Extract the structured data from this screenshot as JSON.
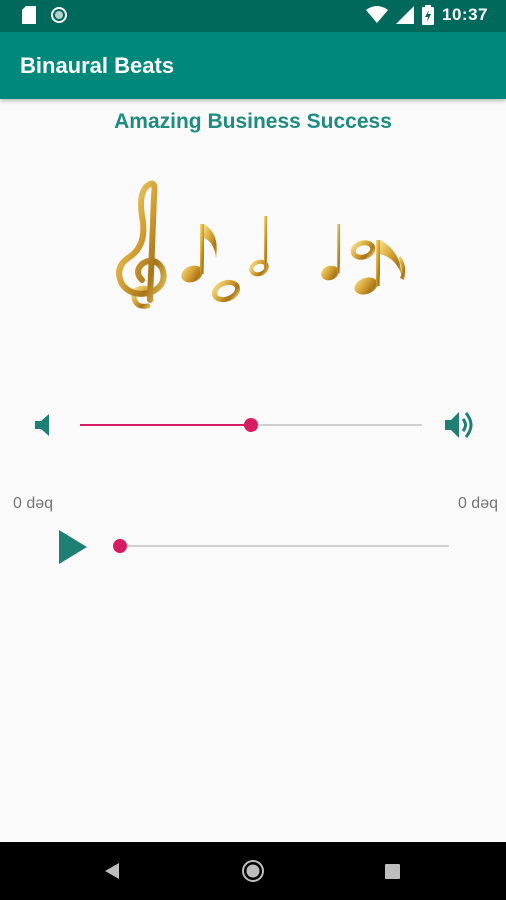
{
  "status_bar": {
    "time": "10:37",
    "icons": [
      "sd-card-icon",
      "circle-notification-icon",
      "wifi-icon",
      "signal-icon",
      "battery-icon"
    ]
  },
  "app_bar": {
    "title": "Binaural Beats"
  },
  "track": {
    "title": "Amazing Business Success"
  },
  "volume": {
    "level": 0.5,
    "down_icon": "volume-down-icon",
    "up_icon": "volume-up-icon"
  },
  "playback": {
    "elapsed": "0 dəq",
    "duration": "0 dəq",
    "progress": 0.0,
    "play_icon": "play-icon"
  },
  "colors": {
    "status_bar": "#00695c",
    "app_bar": "#00897b",
    "accent": "#d81b60",
    "title_text": "#1e8c7e",
    "icon_teal": "#1e8073"
  }
}
